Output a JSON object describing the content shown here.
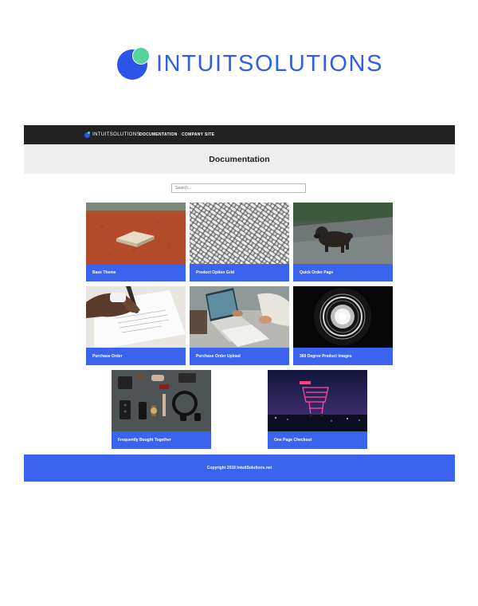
{
  "logo": {
    "wordmark": "INTUITSOLUTIONS",
    "colors": {
      "primary": "#2a55e8",
      "accent": "#55d39a"
    }
  },
  "site": {
    "topnav": {
      "brand": "INTUITSOLUTIONS",
      "links": [
        "DOCUMENTATION",
        "COMPANY SITE"
      ]
    },
    "hero_title": "Documentation",
    "search": {
      "placeholder": "Search..."
    },
    "cards": [
      {
        "title": "Base Theme",
        "image": "baseball-base-on-clay"
      },
      {
        "title": "Product Option Grid",
        "image": "woven-metal-mesh"
      },
      {
        "title": "Quick Order Page",
        "image": "running-dog"
      },
      {
        "title": "Purchase Order",
        "image": "signing-document"
      },
      {
        "title": "Purchase Order Upload",
        "image": "laptops-on-desk"
      },
      {
        "title": "360 Degree Product Images",
        "image": "camera-lens-ring"
      },
      {
        "title": "Frequently Bought Together",
        "image": "flatlay-accessories"
      },
      {
        "title": "One Page Checkout",
        "image": "cart-at-night"
      }
    ],
    "footer": "Copyright 2018 IntuitSolutions.net",
    "colors": {
      "nav_bg": "#222222",
      "hero_bg": "#eeeeee",
      "caption_bg": "#3a63ee"
    }
  }
}
